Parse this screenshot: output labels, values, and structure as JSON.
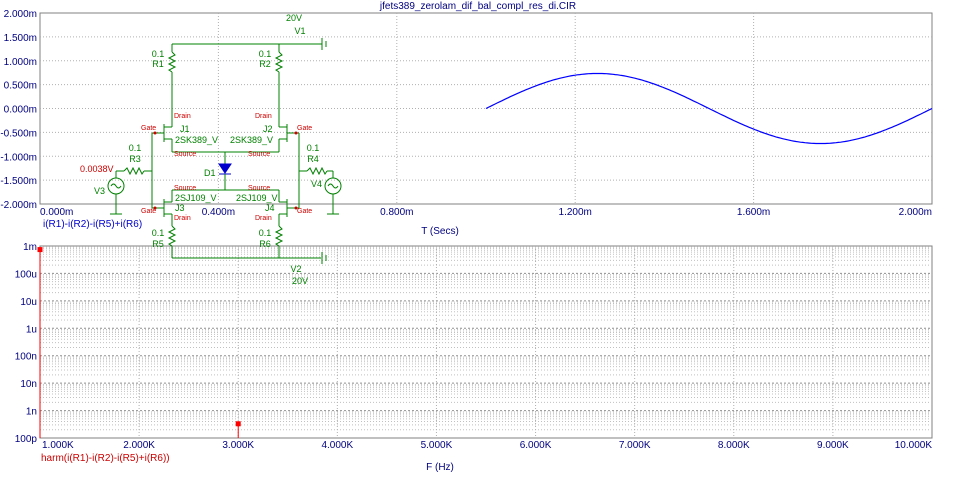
{
  "title": "jfets389_zerolam_dif_bal_compl_res_di.CIR",
  "colors": {
    "grid": "#808080",
    "axis_text": "#000080",
    "trace_time": "#0000ff",
    "trace_harm": "#ff0000",
    "component": "#008000",
    "pin_label": "#cc0000"
  },
  "chart_data": [
    {
      "type": "line",
      "xlabel": "T (Secs)",
      "trace_label": "i(R1)-i(R2)-i(R5)+i(R6)",
      "x_ticks": [
        "0.000m",
        "0.400m",
        "0.800m",
        "1.200m",
        "1.600m",
        "2.000m"
      ],
      "y_ticks": [
        "2.000m",
        "1.500m",
        "1.000m",
        "0.500m",
        "0.000m",
        "-0.500m",
        "-1.000m",
        "-1.500m",
        "-2.000m"
      ],
      "xlim": [
        0,
        2.0
      ],
      "ylim": [
        -2.0,
        2.0
      ],
      "grid": true,
      "series": [
        {
          "x": [
            1.0,
            1.05,
            1.1,
            1.15,
            1.2,
            1.25,
            1.3,
            1.35,
            1.4,
            1.45,
            1.5,
            1.55,
            1.6,
            1.65,
            1.7,
            1.75,
            1.8,
            1.85,
            1.9,
            1.95,
            2.0
          ],
          "y": [
            0.0,
            0.234,
            0.441,
            0.604,
            0.704,
            0.734,
            0.704,
            0.604,
            0.441,
            0.234,
            0.0,
            -0.234,
            -0.441,
            -0.604,
            -0.704,
            -0.734,
            -0.704,
            -0.604,
            -0.441,
            -0.234,
            0.0
          ]
        }
      ]
    },
    {
      "type": "bar",
      "xlabel": "F (Hz)",
      "trace_label": "harm(i(R1)-i(R2)-i(R5)+i(R6))",
      "x_ticks": [
        "1.000K",
        "2.000K",
        "3.000K",
        "4.000K",
        "5.000K",
        "6.000K",
        "7.000K",
        "8.000K",
        "9.000K",
        "10.000K"
      ],
      "y_ticks": [
        "1m",
        "100u",
        "10u",
        "1u",
        "100n",
        "10n",
        "1n",
        "100p"
      ],
      "xlim": [
        1000,
        10000
      ],
      "ylim": [
        1e-10,
        0.001
      ],
      "yscale": "log",
      "grid": true,
      "points": [
        {
          "f": 1000,
          "value": 0.00074
        },
        {
          "f": 3000,
          "value": 3.3e-10
        }
      ]
    }
  ],
  "schematic": {
    "components": [
      {
        "name": "V1",
        "value": "20V"
      },
      {
        "name": "V2",
        "value": "20V"
      },
      {
        "name": "R1",
        "value": "0.1"
      },
      {
        "name": "R2",
        "value": "0.1"
      },
      {
        "name": "R3",
        "value": "0.1"
      },
      {
        "name": "R4",
        "value": "0.1"
      },
      {
        "name": "R5",
        "value": "0.1"
      },
      {
        "name": "R6",
        "value": "0.1"
      },
      {
        "name": "J1",
        "value": "2SK389_V"
      },
      {
        "name": "J2",
        "value": "2SK389_V"
      },
      {
        "name": "J3",
        "value": "2SJ109_V"
      },
      {
        "name": "J4",
        "value": "2SJ109_V"
      },
      {
        "name": "D1",
        "value": ""
      },
      {
        "name": "V3",
        "value": "0.0038V"
      },
      {
        "name": "V4",
        "value": ""
      }
    ],
    "pins": {
      "gate": "Gate",
      "drain": "Drain",
      "source": "Source"
    }
  }
}
